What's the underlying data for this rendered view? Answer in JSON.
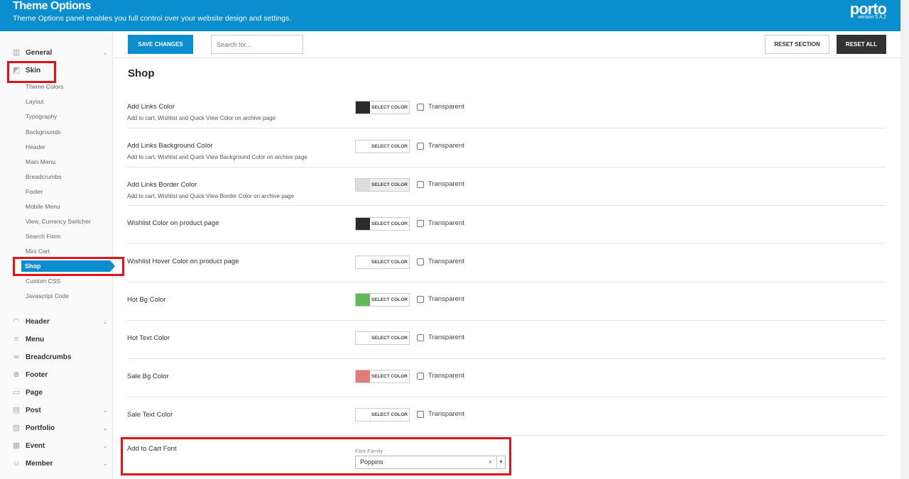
{
  "header": {
    "title": "Theme Options",
    "subtitle": "Theme Options panel enables you full control over your website design and settings.",
    "brand": "porto",
    "version": "version 5.4.2"
  },
  "toolbar": {
    "save_label": "SAVE CHANGES",
    "search_placeholder": "Search for...",
    "reset_section_label": "RESET SECTION",
    "reset_all_label": "RESET ALL"
  },
  "sidebar": {
    "general": "General",
    "skin": "Skin",
    "sub_items": [
      "Theme Colors",
      "Layout",
      "Typography",
      "Backgrounds",
      "Header",
      "Main Menu",
      "Breadcrumbs",
      "Footer",
      "Mobile Menu",
      "View, Currency Switcher",
      "Search Form",
      "Mini Cart"
    ],
    "active_sub": "Shop",
    "sub_items_after": [
      "Custom CSS",
      "Javascript Code"
    ],
    "sections": [
      "Header",
      "Menu",
      "Breadcrumbs",
      "Footer",
      "Page",
      "Post",
      "Portfolio",
      "Event",
      "Member"
    ]
  },
  "main": {
    "section_title": "Shop",
    "select_color_label": "SELECT COLOR",
    "transparent_label": "Transparent",
    "options": [
      {
        "label": "Add Links Color",
        "desc": "Add to cart, Wishlist and Quick View Color on archive page",
        "color": "#2b2b2b"
      },
      {
        "label": "Add Links Background Color",
        "desc": "Add to cart, Wishlist and Quick View Background Color on archive page",
        "color": "#ffffff"
      },
      {
        "label": "Add Links Border Color",
        "desc": "Add to cart, Wishlist and Quick View Border Color on archive page",
        "color": "#dddddd"
      },
      {
        "label": "Wishlist Color on product page",
        "desc": "",
        "color": "#2b2b2b"
      },
      {
        "label": "Wishlist Hover Color on product page",
        "desc": "",
        "color": "#ffffff"
      },
      {
        "label": "Hot Bg Color",
        "desc": "",
        "color": "#62b959"
      },
      {
        "label": "Hot Text Color",
        "desc": "",
        "color": "#ffffff"
      },
      {
        "label": "Sale Bg Color",
        "desc": "",
        "color": "#e27c7c"
      },
      {
        "label": "Sale Text Color",
        "desc": "",
        "color": "#ffffff"
      }
    ],
    "font_option": {
      "label": "Add to Cart Font",
      "field_label": "Font Family",
      "value": "Poppins",
      "clear": "×",
      "arrow": "▼"
    }
  },
  "colors": {
    "accent": "#0a8ed0",
    "highlight_red": "#e1141c",
    "dark_button": "#333333"
  }
}
